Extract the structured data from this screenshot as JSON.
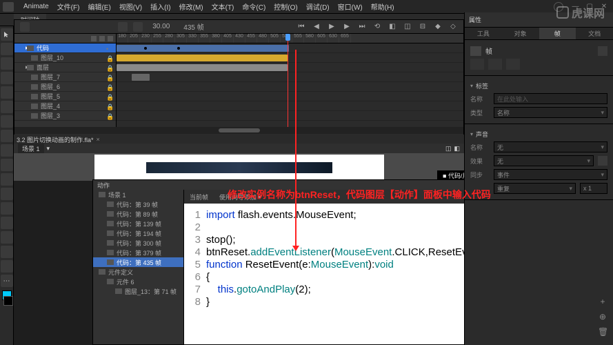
{
  "menubar": {
    "app": "Animate",
    "items": [
      "文件(F)",
      "编辑(E)",
      "视图(V)",
      "插入(I)",
      "修改(M)",
      "文本(T)",
      "命令(C)",
      "控制(O)",
      "调试(D)",
      "窗口(W)",
      "帮助(H)"
    ]
  },
  "doc_tab": "时间轴",
  "timeline": {
    "fps": "30.00",
    "frame_label": "435 帧",
    "frame_marks": [
      "180",
      "205",
      "230",
      "255",
      "280",
      "305",
      "330",
      "355",
      "380",
      "405",
      "430",
      "455",
      "480",
      "505",
      "530",
      "555",
      "580",
      "605",
      "630",
      "655"
    ],
    "layers": [
      {
        "name": "代码",
        "selected": true,
        "lock": false,
        "indent": 1,
        "icon": "code"
      },
      {
        "name": "图层_10",
        "lock": true,
        "indent": 2,
        "icon": "layer"
      },
      {
        "name": "面层",
        "lock": true,
        "indent": 1,
        "icon": "folder"
      },
      {
        "name": "图层_7",
        "lock": true,
        "indent": 2,
        "icon": "layer"
      },
      {
        "name": "图层_6",
        "lock": true,
        "indent": 2,
        "icon": "layer"
      },
      {
        "name": "图层_5",
        "lock": true,
        "indent": 2,
        "icon": "layer"
      },
      {
        "name": "图层_4",
        "lock": true,
        "indent": 2,
        "icon": "layer"
      },
      {
        "name": "图层_3",
        "lock": true,
        "indent": 2,
        "icon": "layer"
      }
    ]
  },
  "doc_file": "3.2 图片切换动画的制作.fla*",
  "scene": {
    "name": "场景 1"
  },
  "stage": {
    "instance_label": "代码/片段"
  },
  "annotation": "修改实例名称为btnReset，代码图层【动作】面板中输入代码",
  "actions": {
    "title": "动作",
    "current_frame": "当前帧",
    "help": "使用向导添加 ▾",
    "tree": [
      {
        "label": "场景 1",
        "indent": 0,
        "icon": "scene"
      },
      {
        "label": "代码：第 39 帧",
        "indent": 1,
        "icon": "code"
      },
      {
        "label": "代码：第 89 帧",
        "indent": 1,
        "icon": "code"
      },
      {
        "label": "代码：第 139 帧",
        "indent": 1,
        "icon": "code"
      },
      {
        "label": "代码：第 194 帧",
        "indent": 1,
        "icon": "code"
      },
      {
        "label": "代码：第 300 帧",
        "indent": 1,
        "icon": "code"
      },
      {
        "label": "代码：第 379 帧",
        "indent": 1,
        "icon": "code"
      },
      {
        "label": "代码：第 435 帧",
        "indent": 1,
        "icon": "code",
        "sel": true
      },
      {
        "label": "元件定义",
        "indent": 0,
        "icon": "def"
      },
      {
        "label": "元件 6",
        "indent": 1,
        "icon": "sym"
      },
      {
        "label": "图层_13：第 71 帧",
        "indent": 2,
        "icon": "code"
      }
    ],
    "code_lines": [
      {
        "n": 1,
        "html": "<span class='kw'>import</span> flash.events.MouseEvent;"
      },
      {
        "n": 2,
        "html": ""
      },
      {
        "n": 3,
        "html": "stop();"
      },
      {
        "n": 4,
        "html": "btnReset.<span class='fn'>addEventListener</span>(<span class='type'>MouseEvent</span>.CLICK,ResetEvent"
      },
      {
        "n": 5,
        "html": "<span class='kw'>function</span> ResetEvent(e:<span class='type'>MouseEvent</span>):<span class='void'>void</span>"
      },
      {
        "n": 6,
        "html": "{"
      },
      {
        "n": 7,
        "html": "    <span class='kw'>this</span>.<span class='fn'>gotoAndPlay</span>(2);"
      },
      {
        "n": 8,
        "html": "}"
      }
    ]
  },
  "right_panel": {
    "header": "属性",
    "tabs": [
      "工具",
      "对象",
      "帧",
      "文档"
    ],
    "active_tab": 2,
    "frame_icon": "帧",
    "sections": {
      "label": {
        "title": "标签",
        "name_lbl": "名称",
        "name_ph": "在此处输入",
        "type_lbl": "类型",
        "type_val": "名称"
      },
      "sound": {
        "title": "声音",
        "name_lbl": "名称",
        "name_val": "无",
        "effect_lbl": "效果",
        "effect_val": "无",
        "sync_lbl": "同步",
        "sync_val": "事件",
        "repeat_lbl": "重复",
        "repeat_val": "x 1"
      }
    }
  },
  "watermark": "虎课网"
}
